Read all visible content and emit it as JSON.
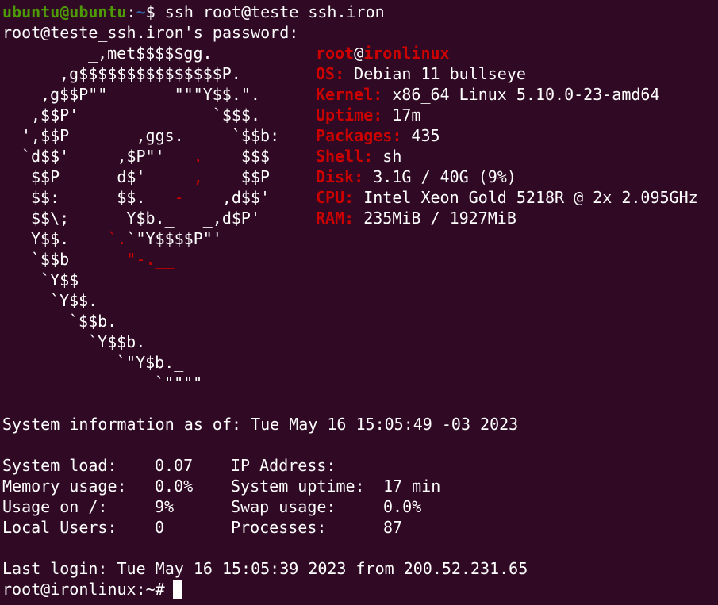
{
  "prompt1": {
    "user_host": "ubuntu@ubuntu",
    "colon": ":",
    "path": "~",
    "symbol": "$",
    "command": "ssh root@teste_ssh.iron"
  },
  "password_prompt": "root@teste_ssh.iron's password:",
  "logo": {
    "l1": "_,met$$$$$gg.",
    "l2": ",g$$$$$$$$$$$$$$$P.",
    "l3": ",g$$P\"\"       \"\"\"Y$$.\".",
    "l4": ",$$P'              `$$$.",
    "l5a": "',$$P       ,ggs.     `$$b:",
    "l6a": "`d$$'     ,$P\"'   ",
    "l6b": ".",
    "l6c": "    $$$",
    "l7a": "$$P      d$'     ",
    "l7b": ",",
    "l7c": "    $$P",
    "l8a": "$$:      $$.   ",
    "l8b": "-",
    "l8c": "    ,d$$'",
    "l9": "$$\\;      Y$b._   _,d$P'",
    "l10a": "Y$$.    ",
    "l10b": "`.",
    "l10c": "`\"Y$$$$P\"'",
    "l11a": "`$$b      ",
    "l11b": "\"-.__",
    "l12": "`Y$$",
    "l13": "`Y$$.",
    "l14": "`$$b.",
    "l15": "`Y$$b.",
    "l16": "`\"Y$b._",
    "l17": "`\"\"\"\""
  },
  "info": {
    "user": "root",
    "at": "@",
    "host": "ironlinux",
    "os_label": "OS:",
    "os_value": " Debian 11 bullseye",
    "kernel_label": "Kernel:",
    "kernel_value": " x86_64 Linux 5.10.0-23-amd64",
    "uptime_label": "Uptime:",
    "uptime_value": " 17m",
    "packages_label": "Packages:",
    "packages_value": " 435",
    "shell_label": "Shell:",
    "shell_value": " sh",
    "disk_label": "Disk:",
    "disk_value": " 3.1G / 40G (9%)",
    "cpu_label": "CPU:",
    "cpu_value": " Intel Xeon Gold 5218R @ 2x 2.095GHz",
    "ram_label": "RAM:",
    "ram_value": " 235MiB / 1927MiB"
  },
  "sysinfo": {
    "header": "System information as of: Tue May 16 15:05:49 -03 2023",
    "rows": [
      {
        "l_label": "System load:",
        "l_value": "0.07",
        "r_label": "IP Address:",
        "r_value": ""
      },
      {
        "l_label": "Memory usage:",
        "l_value": "0.0%",
        "r_label": "System uptime:",
        "r_value": "17 min"
      },
      {
        "l_label": "Usage on /:",
        "l_value": "9%",
        "r_label": "Swap usage:",
        "r_value": "0.0%"
      },
      {
        "l_label": "Local Users:",
        "l_value": "0",
        "r_label": "Processes:",
        "r_value": "87"
      }
    ]
  },
  "last_login": "Last login: Tue May 16 15:05:39 2023 from 200.52.231.65",
  "prompt2": "root@ironlinux:~#"
}
